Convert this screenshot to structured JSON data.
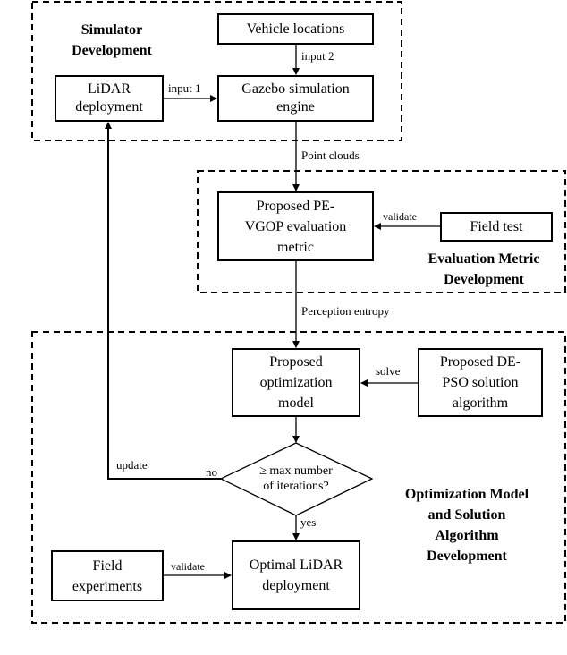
{
  "groups": {
    "simulator": "Simulator\nDevelopment",
    "evaluation": "Evaluation Metric\nDevelopment",
    "optimization": "Optimization Model\nand Solution\nAlgorithm\nDevelopment"
  },
  "nodes": {
    "vehicle_locations": "Vehicle locations",
    "lidar_deployment": "LiDAR\ndeployment",
    "gazebo": "Gazebo simulation\nengine",
    "pe_vgop": "Proposed PE-\nVGOP evaluation\nmetric",
    "field_test": "Field test",
    "opt_model": "Proposed\noptimization\nmodel",
    "de_pso": "Proposed DE-\nPSO solution\nalgorithm",
    "decision": "≥ max number\nof iterations?",
    "optimal_lidar": "Optimal LiDAR\ndeployment",
    "field_experiments": "Field\nexperiments"
  },
  "edges": {
    "input2": "input 2",
    "input1": "input 1",
    "point_clouds": "Point clouds",
    "validate1": "validate",
    "perception_entropy": "Perception entropy",
    "solve": "solve",
    "update": "update",
    "no": "no",
    "yes": "yes",
    "validate2": "validate"
  }
}
